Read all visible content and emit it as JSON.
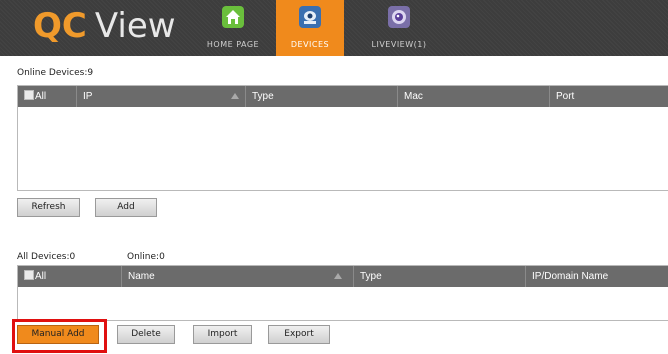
{
  "header": {
    "logo_brand": "QC",
    "logo_product": "View",
    "tabs": [
      {
        "label": "HOME PAGE",
        "icon": "home-icon",
        "color": "#6abf3c"
      },
      {
        "label": "DEVICES",
        "icon": "device-icon",
        "color": "#3a6fb0"
      },
      {
        "label": "LIVEVIEW(1)",
        "icon": "camera-icon",
        "color": "#7a6fa8"
      }
    ],
    "active_color": "#f08a1c"
  },
  "online": {
    "count_label": "Online Devices:9",
    "columns": [
      "All",
      "IP",
      "Type",
      "Mac",
      "Port"
    ],
    "buttons": {
      "refresh": "Refresh",
      "add": "Add"
    }
  },
  "all_devices": {
    "count_label": "All Devices:0",
    "online_label": "Online:0",
    "columns": [
      "All",
      "Name",
      "Type",
      "IP/Domain Name"
    ],
    "buttons": {
      "manual_add": "Manual Add",
      "delete": "Delete",
      "import": "Import",
      "export": "Export"
    }
  },
  "colors": {
    "accent": "#f08a1c",
    "highlight": "#e01010",
    "grid_header": "#6b6b6b"
  }
}
